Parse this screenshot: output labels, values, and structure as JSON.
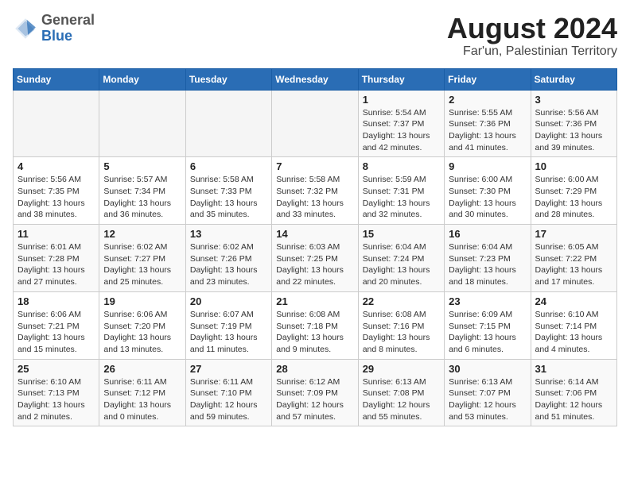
{
  "header": {
    "logo_general": "General",
    "logo_blue": "Blue",
    "month_year": "August 2024",
    "location": "Far'un, Palestinian Territory"
  },
  "days_of_week": [
    "Sunday",
    "Monday",
    "Tuesday",
    "Wednesday",
    "Thursday",
    "Friday",
    "Saturday"
  ],
  "weeks": [
    [
      {
        "day": "",
        "info": ""
      },
      {
        "day": "",
        "info": ""
      },
      {
        "day": "",
        "info": ""
      },
      {
        "day": "",
        "info": ""
      },
      {
        "day": "1",
        "info": "Sunrise: 5:54 AM\nSunset: 7:37 PM\nDaylight: 13 hours\nand 42 minutes."
      },
      {
        "day": "2",
        "info": "Sunrise: 5:55 AM\nSunset: 7:36 PM\nDaylight: 13 hours\nand 41 minutes."
      },
      {
        "day": "3",
        "info": "Sunrise: 5:56 AM\nSunset: 7:36 PM\nDaylight: 13 hours\nand 39 minutes."
      }
    ],
    [
      {
        "day": "4",
        "info": "Sunrise: 5:56 AM\nSunset: 7:35 PM\nDaylight: 13 hours\nand 38 minutes."
      },
      {
        "day": "5",
        "info": "Sunrise: 5:57 AM\nSunset: 7:34 PM\nDaylight: 13 hours\nand 36 minutes."
      },
      {
        "day": "6",
        "info": "Sunrise: 5:58 AM\nSunset: 7:33 PM\nDaylight: 13 hours\nand 35 minutes."
      },
      {
        "day": "7",
        "info": "Sunrise: 5:58 AM\nSunset: 7:32 PM\nDaylight: 13 hours\nand 33 minutes."
      },
      {
        "day": "8",
        "info": "Sunrise: 5:59 AM\nSunset: 7:31 PM\nDaylight: 13 hours\nand 32 minutes."
      },
      {
        "day": "9",
        "info": "Sunrise: 6:00 AM\nSunset: 7:30 PM\nDaylight: 13 hours\nand 30 minutes."
      },
      {
        "day": "10",
        "info": "Sunrise: 6:00 AM\nSunset: 7:29 PM\nDaylight: 13 hours\nand 28 minutes."
      }
    ],
    [
      {
        "day": "11",
        "info": "Sunrise: 6:01 AM\nSunset: 7:28 PM\nDaylight: 13 hours\nand 27 minutes."
      },
      {
        "day": "12",
        "info": "Sunrise: 6:02 AM\nSunset: 7:27 PM\nDaylight: 13 hours\nand 25 minutes."
      },
      {
        "day": "13",
        "info": "Sunrise: 6:02 AM\nSunset: 7:26 PM\nDaylight: 13 hours\nand 23 minutes."
      },
      {
        "day": "14",
        "info": "Sunrise: 6:03 AM\nSunset: 7:25 PM\nDaylight: 13 hours\nand 22 minutes."
      },
      {
        "day": "15",
        "info": "Sunrise: 6:04 AM\nSunset: 7:24 PM\nDaylight: 13 hours\nand 20 minutes."
      },
      {
        "day": "16",
        "info": "Sunrise: 6:04 AM\nSunset: 7:23 PM\nDaylight: 13 hours\nand 18 minutes."
      },
      {
        "day": "17",
        "info": "Sunrise: 6:05 AM\nSunset: 7:22 PM\nDaylight: 13 hours\nand 17 minutes."
      }
    ],
    [
      {
        "day": "18",
        "info": "Sunrise: 6:06 AM\nSunset: 7:21 PM\nDaylight: 13 hours\nand 15 minutes."
      },
      {
        "day": "19",
        "info": "Sunrise: 6:06 AM\nSunset: 7:20 PM\nDaylight: 13 hours\nand 13 minutes."
      },
      {
        "day": "20",
        "info": "Sunrise: 6:07 AM\nSunset: 7:19 PM\nDaylight: 13 hours\nand 11 minutes."
      },
      {
        "day": "21",
        "info": "Sunrise: 6:08 AM\nSunset: 7:18 PM\nDaylight: 13 hours\nand 9 minutes."
      },
      {
        "day": "22",
        "info": "Sunrise: 6:08 AM\nSunset: 7:16 PM\nDaylight: 13 hours\nand 8 minutes."
      },
      {
        "day": "23",
        "info": "Sunrise: 6:09 AM\nSunset: 7:15 PM\nDaylight: 13 hours\nand 6 minutes."
      },
      {
        "day": "24",
        "info": "Sunrise: 6:10 AM\nSunset: 7:14 PM\nDaylight: 13 hours\nand 4 minutes."
      }
    ],
    [
      {
        "day": "25",
        "info": "Sunrise: 6:10 AM\nSunset: 7:13 PM\nDaylight: 13 hours\nand 2 minutes."
      },
      {
        "day": "26",
        "info": "Sunrise: 6:11 AM\nSunset: 7:12 PM\nDaylight: 13 hours\nand 0 minutes."
      },
      {
        "day": "27",
        "info": "Sunrise: 6:11 AM\nSunset: 7:10 PM\nDaylight: 12 hours\nand 59 minutes."
      },
      {
        "day": "28",
        "info": "Sunrise: 6:12 AM\nSunset: 7:09 PM\nDaylight: 12 hours\nand 57 minutes."
      },
      {
        "day": "29",
        "info": "Sunrise: 6:13 AM\nSunset: 7:08 PM\nDaylight: 12 hours\nand 55 minutes."
      },
      {
        "day": "30",
        "info": "Sunrise: 6:13 AM\nSunset: 7:07 PM\nDaylight: 12 hours\nand 53 minutes."
      },
      {
        "day": "31",
        "info": "Sunrise: 6:14 AM\nSunset: 7:06 PM\nDaylight: 12 hours\nand 51 minutes."
      }
    ]
  ]
}
